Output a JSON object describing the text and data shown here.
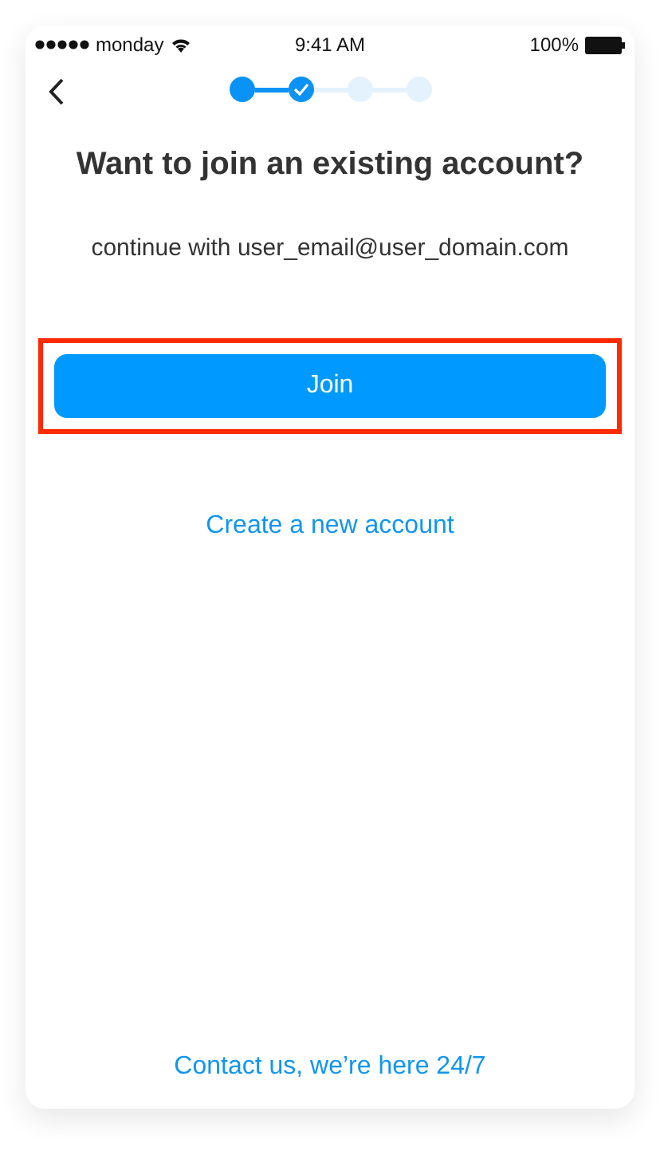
{
  "status_bar": {
    "carrier": "monday",
    "time": "9:41 AM",
    "battery": "100%"
  },
  "stepper": [
    {
      "reached": true,
      "checked": false
    },
    {
      "reached": true,
      "checked": true
    },
    {
      "reached": false,
      "checked": false
    },
    {
      "reached": false,
      "checked": false
    }
  ],
  "title": "Want to join an existing account?",
  "subtitle": "continue with user_email@user_domain.com",
  "join_button": {
    "label": "Join",
    "highlighted": true
  },
  "create_link": "Create a new account",
  "contact_link": "Contact us, we’re here 24/7"
}
